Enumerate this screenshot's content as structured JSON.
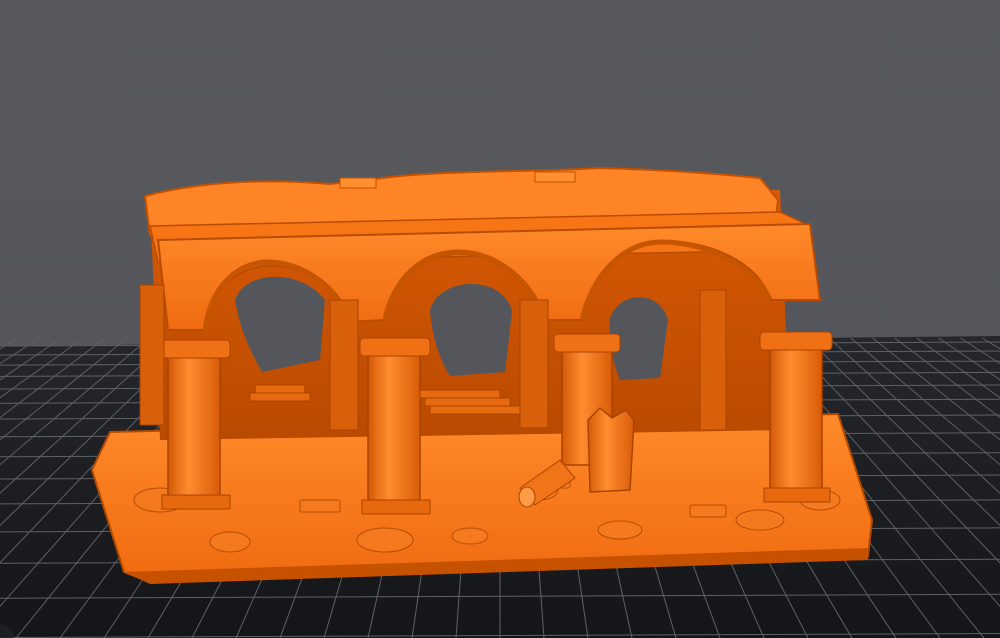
{
  "viewport": {
    "background_color": "#55565b",
    "grid_color": "#1a1b1f",
    "grid_line_color": "#6a6c73",
    "model_color": "#ff7a1a",
    "model_shadow_color": "#c45200",
    "model_highlight_color": "#ff9a45"
  },
  "scene": {
    "object": "ruined-arcade-model",
    "icons": [
      "orbit-handle-icon"
    ]
  }
}
